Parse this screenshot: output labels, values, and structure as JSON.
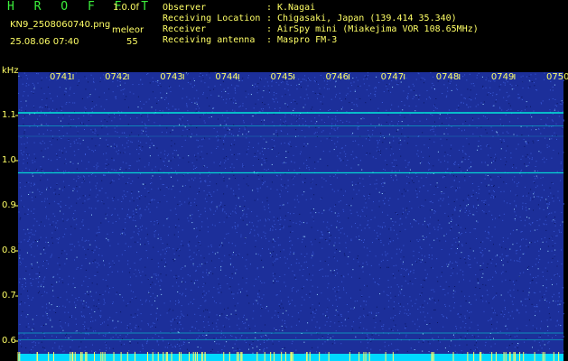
{
  "header": {
    "app_title": "H R O F F T",
    "version": "1.0.0f",
    "filename": "KN9_2508060740.png",
    "mode": "meleor",
    "datetime": "25.08.06 07:40",
    "count": "55"
  },
  "metadata": [
    {
      "key": "Observer",
      "value": "K.Nagai"
    },
    {
      "key": "Receiving Location",
      "value": "Chigasaki, Japan (139.414 35.340)"
    },
    {
      "key": "Receiver",
      "value": "AirSpy mini (Miakejima VOR 108.65MHz)"
    },
    {
      "key": "Receiving antenna",
      "value": "Maspro FM-3"
    }
  ],
  "spectrogram": {
    "y_unit": "kHz",
    "y_labels": [
      "1.1",
      "1.0",
      "0.9",
      "0.8",
      "0.7",
      "0.6"
    ],
    "y_values": [
      1.1,
      1.0,
      0.9,
      0.8,
      0.7,
      0.6
    ],
    "time_labels": [
      "0741",
      "0742",
      "0743",
      "0744",
      "0745",
      "0746",
      "0747",
      "0748",
      "0749",
      "0750"
    ],
    "colors": {
      "background": "#1c2f9a",
      "noise": "#3a5ad8",
      "signal": "#00ffe0",
      "label": "#ffff66",
      "bottom_strip": "#00d8ff"
    }
  }
}
